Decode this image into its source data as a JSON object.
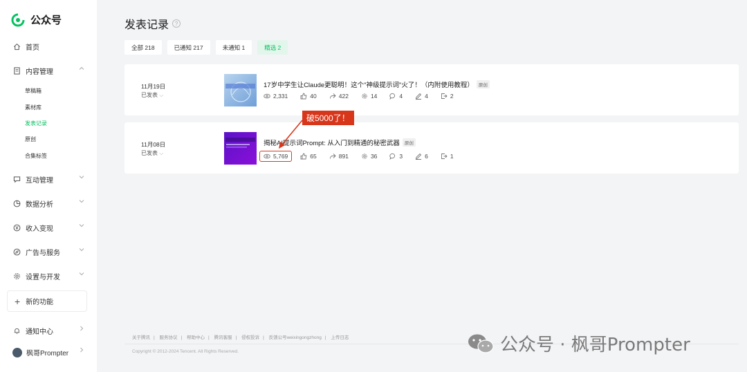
{
  "brand": {
    "name": "公众号"
  },
  "sidebar": {
    "home": "首页",
    "content_mgmt": "内容管理",
    "sub": [
      "草稿箱",
      "素材库",
      "发表记录",
      "原创",
      "合集标签"
    ],
    "interaction": "互动管理",
    "analytics": "数据分析",
    "income": "收入变现",
    "ads": "广告与服务",
    "settings": "设置与开发",
    "new_features": "新的功能",
    "notifications": "通知中心",
    "user": "枫哥Prompter"
  },
  "page": {
    "title": "发表记录"
  },
  "tabs": [
    {
      "label": "全部 218",
      "active": false
    },
    {
      "label": "已通知 217",
      "active": false
    },
    {
      "label": "未通知 1",
      "active": false
    },
    {
      "label": "精选 2",
      "active": true
    }
  ],
  "articles": [
    {
      "date": "11月19日",
      "status": "已发表",
      "title": "17岁中学生让Claude更聪明！这个\"神级提示词\"火了！（内附使用教程）",
      "tag": "原创",
      "views": "2,331",
      "likes": "40",
      "shares": "422",
      "wows": "14",
      "comments": "4",
      "notes": "4",
      "quotes": "2"
    },
    {
      "date": "11月08日",
      "status": "已发表",
      "title": "揭秘AI提示词Prompt: 从入门到精通的秘密武器",
      "tag": "原创",
      "views": "5,769",
      "likes": "65",
      "shares": "891",
      "wows": "36",
      "comments": "3",
      "notes": "6",
      "quotes": "1"
    }
  ],
  "callout": "破5000了！",
  "footer": {
    "links": [
      "关于腾讯",
      "服务协议",
      "帮助中心",
      "腾讯客服",
      "侵权投诉",
      "反馈公号weixingongzhong",
      "上传日志"
    ],
    "copyright": "Copyright © 2012-2024 Tencent. All Rights Reserved."
  },
  "watermark": "公众号 · 枫哥Prompter",
  "colors": {
    "accent": "#07c160",
    "callout": "#d8361b"
  }
}
